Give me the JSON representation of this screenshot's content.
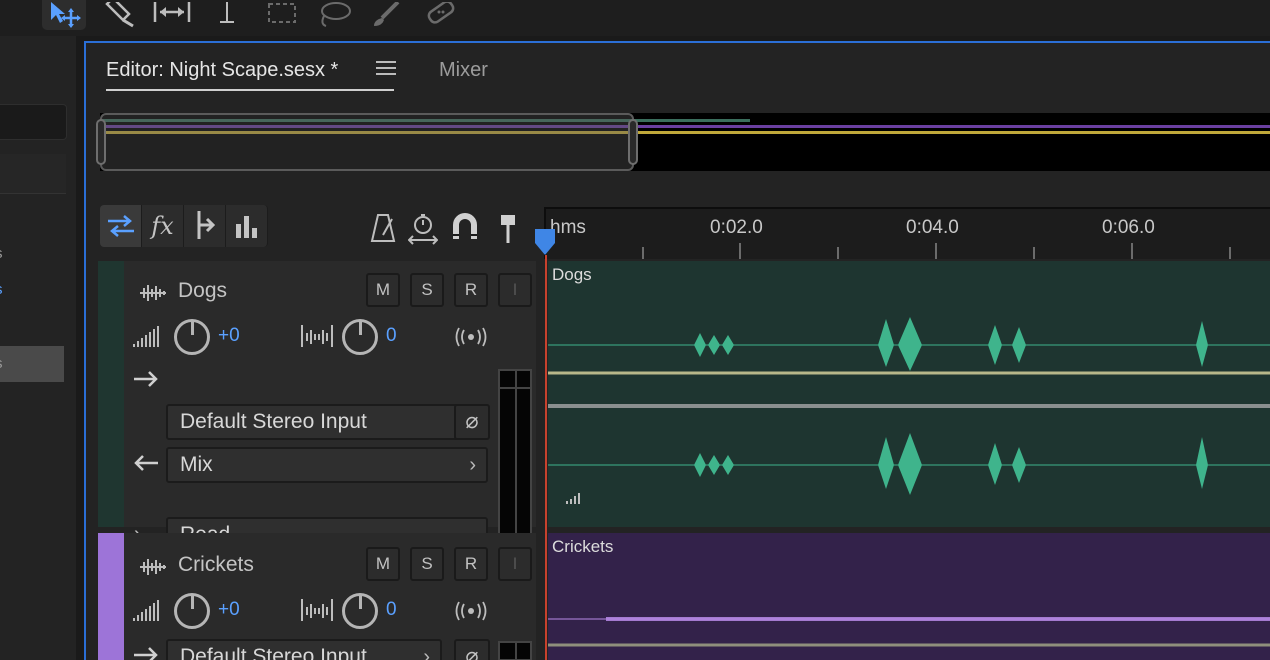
{
  "editor_tab": {
    "label": "Editor: Night Scape.sesx *"
  },
  "mixer_tab": {
    "label": "Mixer"
  },
  "left_panel": {
    "rows": [
      {
        "label": "."
      },
      {
        "label": "s"
      },
      {
        "label": "s"
      },
      {
        "label": ")"
      },
      {
        "label": "s"
      }
    ]
  },
  "ruler": {
    "unit_label": "hms",
    "marks": [
      "0:02.0",
      "0:04.0",
      "0:06.0"
    ]
  },
  "track_tools": {
    "fx_label": "fx"
  },
  "tracks": [
    {
      "name": "Dogs",
      "color": "#1f3630",
      "header_color": "#1f3630",
      "mute": "M",
      "solo": "S",
      "record": "R",
      "monitor": "I",
      "volume": "+0",
      "pan": "0",
      "input": "Default Stereo Input",
      "output": "Mix",
      "automation": "Read",
      "clip_label": "Dogs",
      "clip_color": "#1e3530",
      "wave_color": "#3fb48c"
    },
    {
      "name": "Crickets",
      "color": "#9d74d8",
      "header_color": "#9d74d8",
      "mute": "M",
      "solo": "S",
      "record": "R",
      "monitor": "I",
      "volume": "+0",
      "pan": "0",
      "input": "Default Stereo Input",
      "clip_label": "Crickets",
      "clip_color": "#33224a",
      "wave_color": "#b88ae8"
    }
  ],
  "colors": {
    "accent": "#2b6fd6",
    "value_blue": "#5aa0ff",
    "playhead": "#c8412d"
  }
}
